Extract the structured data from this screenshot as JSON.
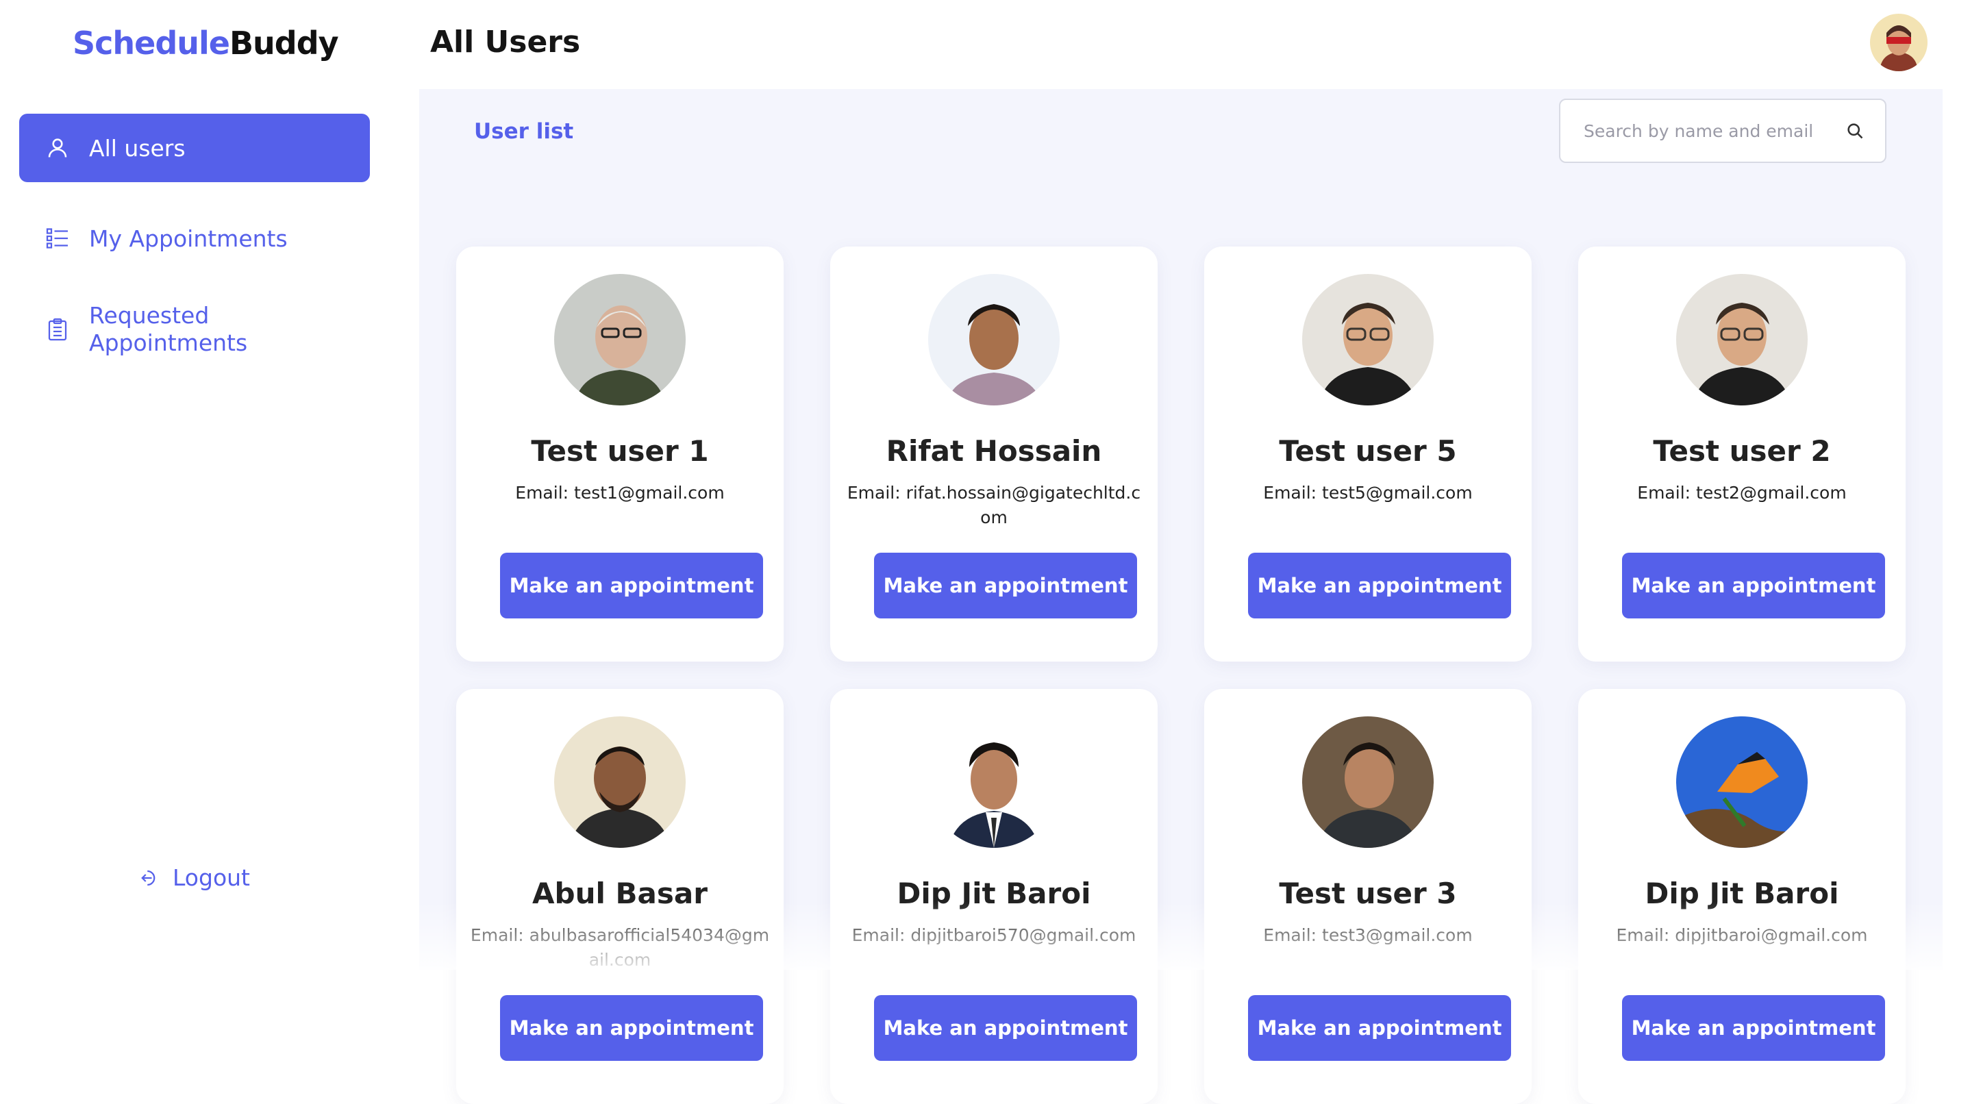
{
  "brand": {
    "part1": "Schedule",
    "part2": "Buddy"
  },
  "colors": {
    "accent": "#5560ea",
    "panel": "#f4f5fd"
  },
  "sidebar": {
    "items": [
      {
        "label": "All users",
        "icon": "user-icon",
        "active": true
      },
      {
        "label": "My Appointments",
        "icon": "list-icon",
        "active": false
      },
      {
        "label": "Requested Appointments",
        "icon": "clipboard-icon",
        "active": false
      }
    ],
    "logout": {
      "label": "Logout",
      "icon": "logout-icon"
    }
  },
  "header": {
    "title": "All Users",
    "avatar": "profile-avatar"
  },
  "main": {
    "section_title": "User list",
    "search": {
      "placeholder": "Search by name and email",
      "icon": "search-icon"
    },
    "button_label": "Make an appointment",
    "users": [
      {
        "name": "Test user 1",
        "email": "Email: test1@gmail.com"
      },
      {
        "name": "Rifat Hossain",
        "email": "Email: rifat.hossain@gigatechltd.com"
      },
      {
        "name": "Test user 5",
        "email": "Email: test5@gmail.com"
      },
      {
        "name": "Test user 2",
        "email": "Email: test2@gmail.com"
      },
      {
        "name": "Abul Basar",
        "email": "Email: abulbasarofficial54034@gmail.com"
      },
      {
        "name": "Dip Jit Baroi",
        "email": "Email: dipjitbaroi570@gmail.com"
      },
      {
        "name": "Test user 3",
        "email": "Email: test3@gmail.com"
      },
      {
        "name": "Dip Jit Baroi",
        "email": "Email: dipjitbaroi@gmail.com"
      }
    ]
  }
}
